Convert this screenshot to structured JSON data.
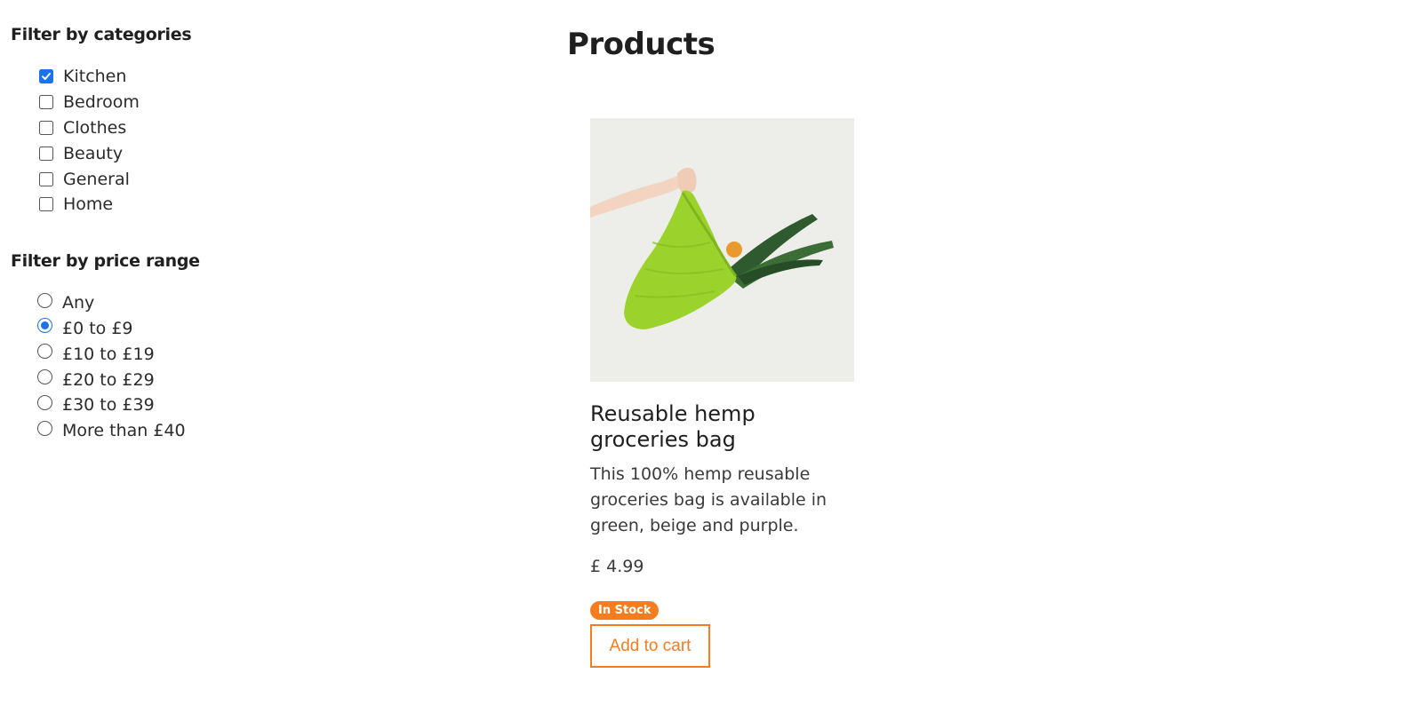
{
  "filters": {
    "categories": {
      "heading": "Filter by categories",
      "options": [
        {
          "label": "Kitchen",
          "checked": true
        },
        {
          "label": "Bedroom",
          "checked": false
        },
        {
          "label": "Clothes",
          "checked": false
        },
        {
          "label": "Beauty",
          "checked": false
        },
        {
          "label": "General",
          "checked": false
        },
        {
          "label": "Home",
          "checked": false
        }
      ]
    },
    "price": {
      "heading": "Filter by price range",
      "options": [
        {
          "label": "Any",
          "selected": false
        },
        {
          "label": "£0 to £9",
          "selected": true
        },
        {
          "label": "£10 to £19",
          "selected": false
        },
        {
          "label": "£20 to £29",
          "selected": false
        },
        {
          "label": "£30 to £39",
          "selected": false
        },
        {
          "label": "More than £40",
          "selected": false
        }
      ]
    }
  },
  "main": {
    "title": "Products",
    "products": [
      {
        "name": "Reusable hemp groceries bag",
        "description": "This 100% hemp reusable groceries bag is available in green, beige and purple.",
        "price": "£ 4.99",
        "stock": "In Stock",
        "add_to_cart": "Add to cart",
        "image": "hand-holding-green-mesh-bag-with-leeks"
      }
    ]
  },
  "colors": {
    "accent": "#f57c1f",
    "control_blue": "#1a73e8"
  }
}
